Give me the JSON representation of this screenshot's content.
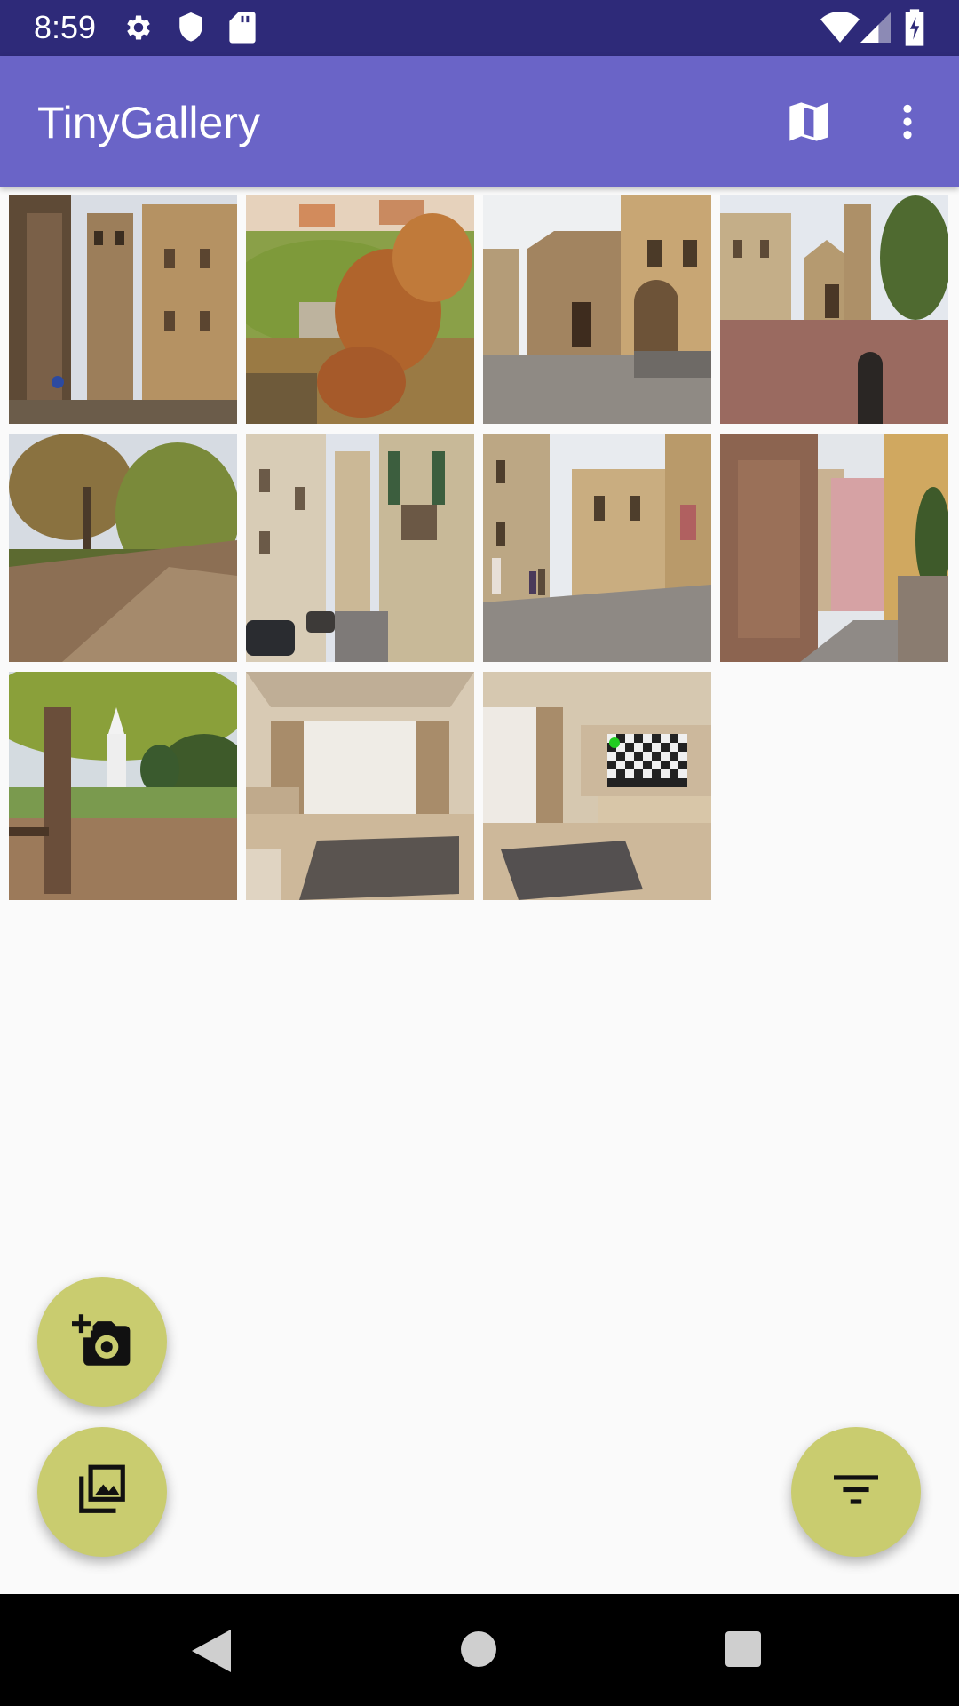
{
  "status_bar": {
    "time": "8:59",
    "icons": [
      "settings-gear-icon",
      "shield-icon",
      "sd-card-icon",
      "wifi-icon",
      "cell-signal-icon",
      "battery-charging-icon"
    ]
  },
  "app_bar": {
    "title": "TinyGallery",
    "actions": [
      "map-icon",
      "more-vert-icon"
    ]
  },
  "gallery": {
    "photos": [
      {
        "subject": "medieval tower between buildings"
      },
      {
        "subject": "hillside garden with autumn leaves"
      },
      {
        "subject": "church piazza with steps"
      },
      {
        "subject": "church square with bollard"
      },
      {
        "subject": "autumn tree-lined path"
      },
      {
        "subject": "narrow street with cars"
      },
      {
        "subject": "narrow street with people"
      },
      {
        "subject": "stone alley with pink house"
      },
      {
        "subject": "park tree with white monument"
      },
      {
        "subject": "empty wooden room"
      },
      {
        "subject": "wooden room with checkerboard screen"
      }
    ]
  },
  "fabs": {
    "add_photo": "add-a-photo-icon",
    "gallery": "photo-library-icon",
    "filter": "filter-icon"
  },
  "nav_bar": {
    "buttons": [
      "back-icon",
      "home-icon",
      "recents-icon"
    ]
  },
  "colors": {
    "status_bar": "#2e2a79",
    "app_bar": "#6a64c7",
    "fab": "#c9cc6f",
    "background": "#fafafa"
  }
}
